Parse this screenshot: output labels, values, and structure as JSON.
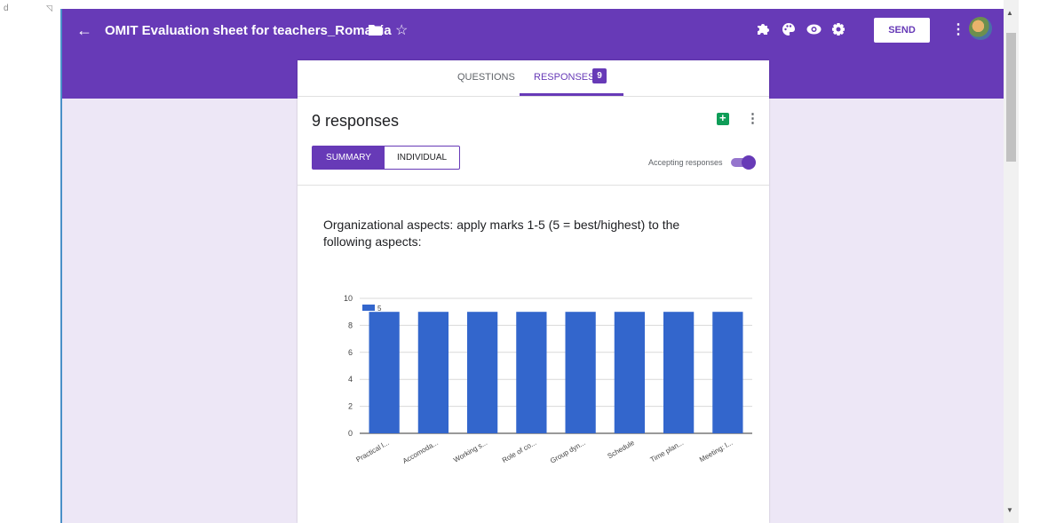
{
  "header": {
    "title": "OMIT Evaluation sheet for teachers_Romania",
    "send_label": "SEND"
  },
  "tabs": {
    "questions_label": "QUESTIONS",
    "responses_label": "RESPONSES",
    "responses_badge": "9"
  },
  "summary": {
    "responses_count": "9 responses",
    "summary_label": "SUMMARY",
    "individual_label": "INDIVIDUAL",
    "accepting_label": "Accepting responses",
    "accepting": true
  },
  "question": {
    "text": "Organizational aspects: apply marks 1-5 (5 = best/highest) to the following aspects:"
  },
  "icons": {
    "back": "arrow-back-icon",
    "folder": "folder-icon",
    "star": "star-outline-icon",
    "addons": "puzzle-piece-icon",
    "palette": "palette-icon",
    "preview": "eye-icon",
    "settings": "gear-icon",
    "more": "more-vert-icon",
    "sheets": "google-sheets-icon",
    "help": "help-icon"
  },
  "colors": {
    "brand": "#673ab7",
    "background": "#ede7f6",
    "bar": "#3366cc"
  },
  "chart_data": {
    "type": "bar",
    "categories": [
      "Practical l...",
      "Accomoda...",
      "Working s...",
      "Role of co...",
      "Group dyn...",
      "Schedule",
      "Time plan...",
      "Meeting: l..."
    ],
    "series": [
      {
        "name": "5",
        "values": [
          9,
          9,
          9,
          9,
          9,
          9,
          9,
          9
        ]
      }
    ],
    "yticks": [
      "0",
      "2",
      "4",
      "6",
      "8",
      "10"
    ],
    "ylim": [
      0,
      10
    ],
    "grid": true,
    "legend": "top-left"
  },
  "gutter": {
    "left_char": "d"
  }
}
